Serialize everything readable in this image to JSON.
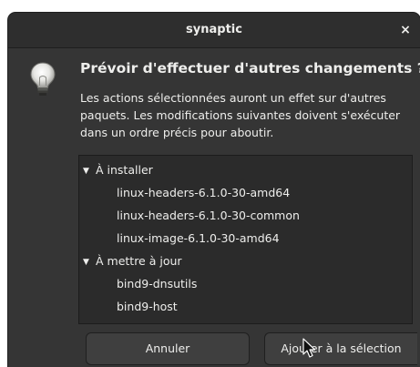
{
  "window": {
    "title": "synaptic",
    "close_label": "×"
  },
  "dialog": {
    "icon": "lightbulb-icon",
    "heading": "Prévoir d'effectuer d'autres changements ?",
    "description": "Les actions sélectionnées auront un effet sur d'autres paquets. Les modifications suivantes doivent s'exécuter dans un ordre précis pour aboutir."
  },
  "tree": {
    "groups": [
      {
        "label": "À installer",
        "expanded": true,
        "items": [
          "linux-headers-6.1.0-30-amd64",
          "linux-headers-6.1.0-30-common",
          "linux-image-6.1.0-30-amd64"
        ]
      },
      {
        "label": "À mettre à jour",
        "expanded": true,
        "items": [
          "bind9-dnsutils",
          "bind9-host"
        ]
      }
    ]
  },
  "buttons": {
    "cancel": "Annuler",
    "add": "Ajouter à la sélection"
  },
  "colors": {
    "window_bg": "#353535",
    "titlebar_bg": "#2e2e2e",
    "list_bg": "#2b2b2b",
    "text": "#eeeeec"
  }
}
